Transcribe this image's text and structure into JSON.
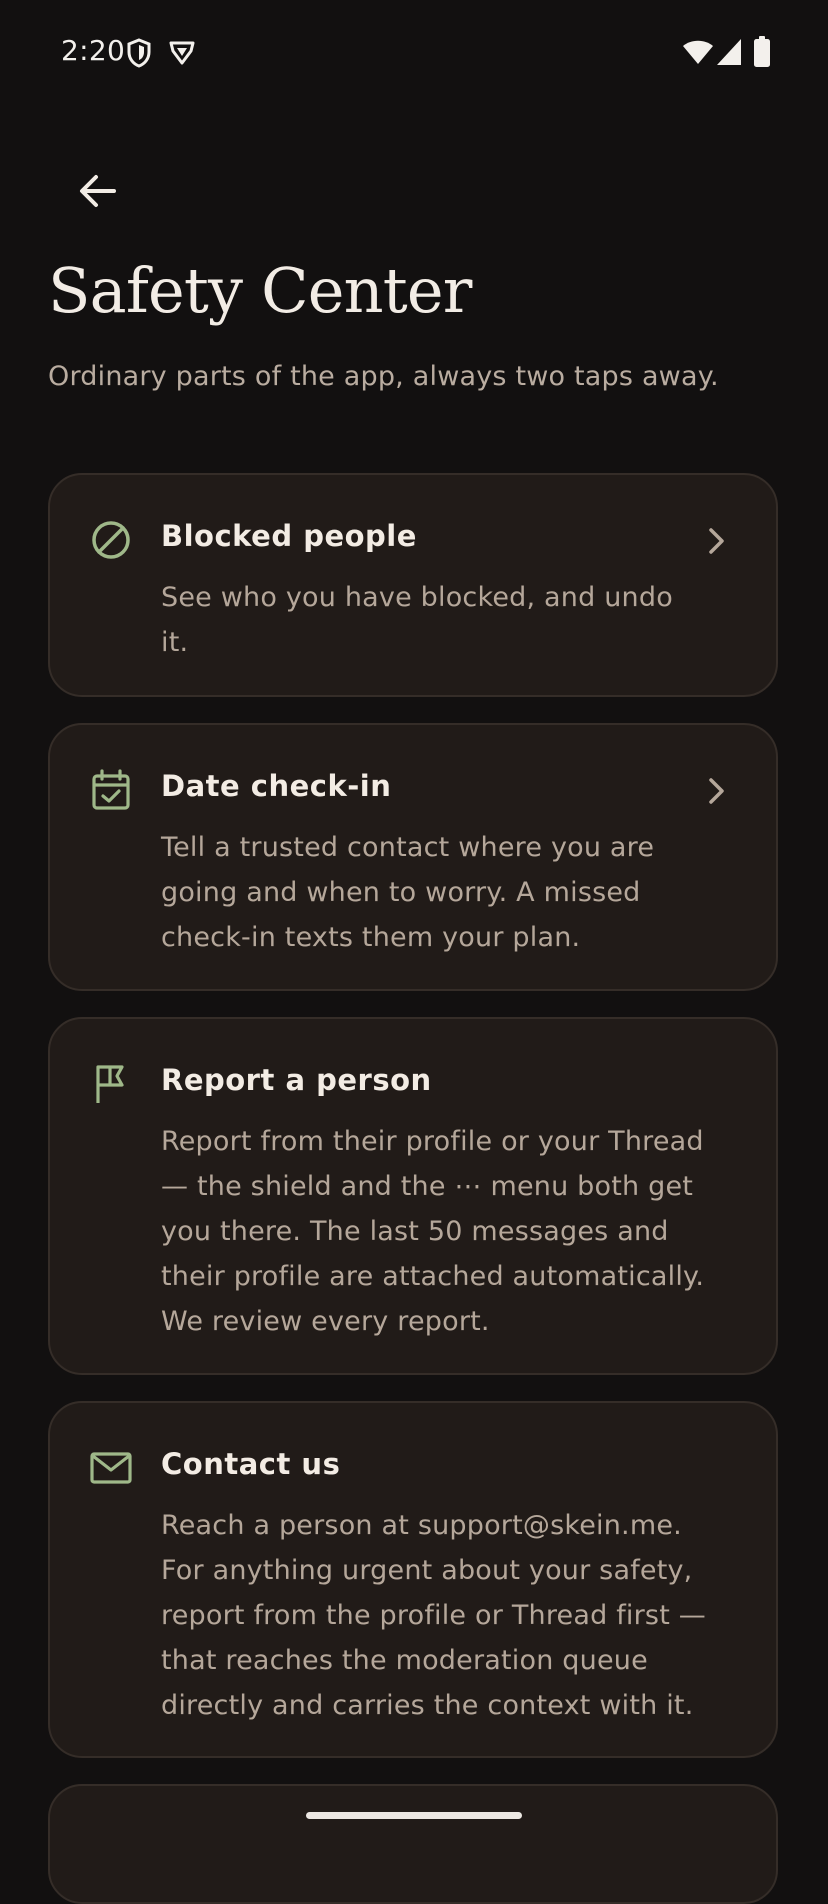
{
  "status_bar": {
    "time": "2:20"
  },
  "header": {
    "title": "Safety Center",
    "subtitle": "Ordinary parts of the app, always two taps away."
  },
  "cards": [
    {
      "title": "Blocked people",
      "description": "See who you have blocked, and undo it.",
      "icon": "block-icon"
    },
    {
      "title": "Date check-in",
      "description": "Tell a trusted contact where you are going and when to worry. A missed check-in texts them your plan.",
      "icon": "calendar-check-icon"
    },
    {
      "title": "Report a person",
      "description": "Report from their profile or your Thread — the shield and the ⋯ menu both get you there. The last 50 messages and their profile are attached automatically. We review every report.",
      "icon": "flag-icon"
    },
    {
      "title": "Contact us",
      "description": "Reach a person at support@skein.me. For anything urgent about your safety, report from the profile or Thread first — that reaches the moderation queue directly and carries the context with it.",
      "icon": "mail-icon"
    }
  ],
  "colors": {
    "background": "#121010",
    "card": "#211b18",
    "accent": "#9fb889"
  }
}
